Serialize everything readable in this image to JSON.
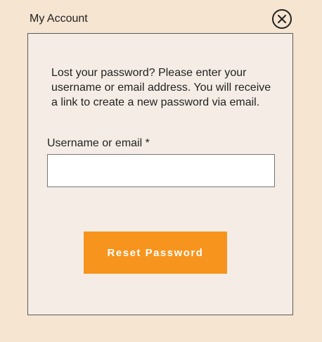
{
  "header": {
    "title": "My Account",
    "close_icon": "close-circle-icon"
  },
  "form": {
    "intro_line1": "Lost your password? Please enter your",
    "intro_line2": "username or email address. You will receive",
    "intro_line3": "a link to create a new password via email.",
    "field_label": "Username or email *",
    "field_value": "",
    "field_placeholder": "",
    "submit_label": "Reset Password"
  },
  "colors": {
    "page_background": "#f5e5d1",
    "panel_background": "#f5ede5",
    "button_background": "#f7941d",
    "button_text": "#ffffff"
  }
}
